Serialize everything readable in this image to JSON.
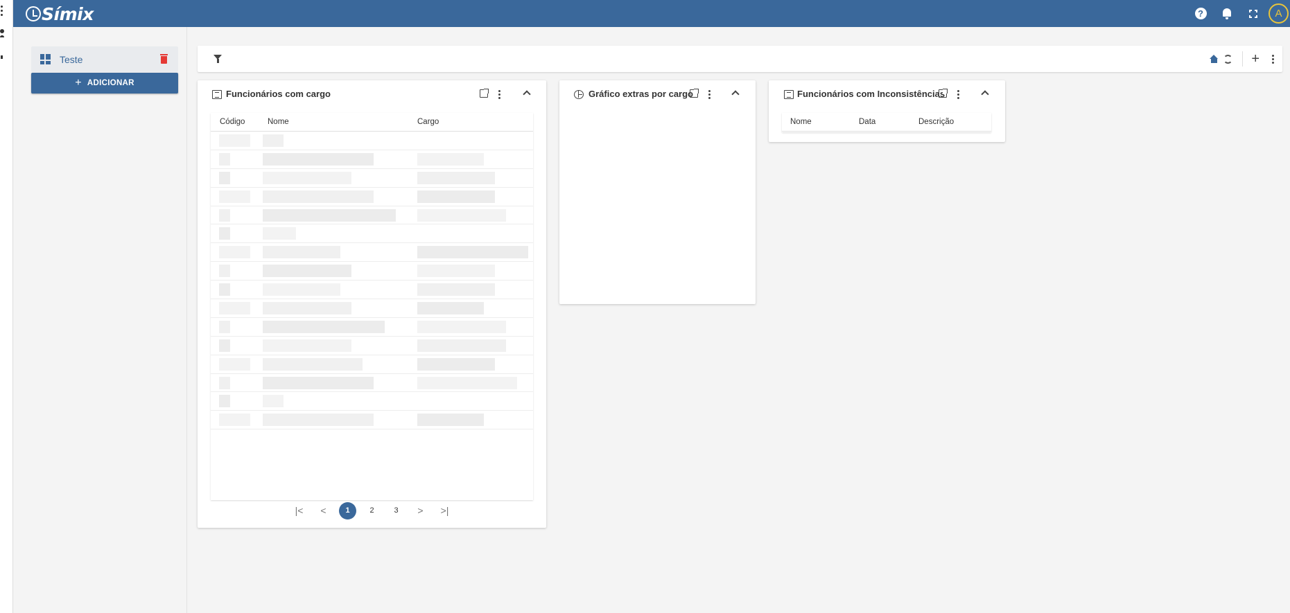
{
  "app": {
    "brand": "Símix",
    "user_initial": "A"
  },
  "sidebar": {
    "dashboards": [
      {
        "label": "Teste"
      }
    ],
    "add_label": "ADICIONAR"
  },
  "widgets": {
    "employees_by_role": {
      "title": "Funcionários com cargo",
      "columns": [
        "Código",
        "Nome",
        "Cargo"
      ],
      "row_count": 16,
      "pagination": {
        "first": "|<",
        "prev": "<",
        "pages": [
          "1",
          "2",
          "3"
        ],
        "current": "1",
        "next": ">",
        "last": ">|"
      }
    },
    "extras_chart": {
      "title": "Gráfico extras por cargo"
    },
    "inconsistencies": {
      "title": "Funcionários com Inconsistências",
      "columns": [
        "Nome",
        "Data",
        "Descrição"
      ]
    }
  },
  "colors": {
    "primary": "#3a689b",
    "avatar_ring": "#e8c43a",
    "delete": "#e53935",
    "background": "#f4f4f4"
  }
}
